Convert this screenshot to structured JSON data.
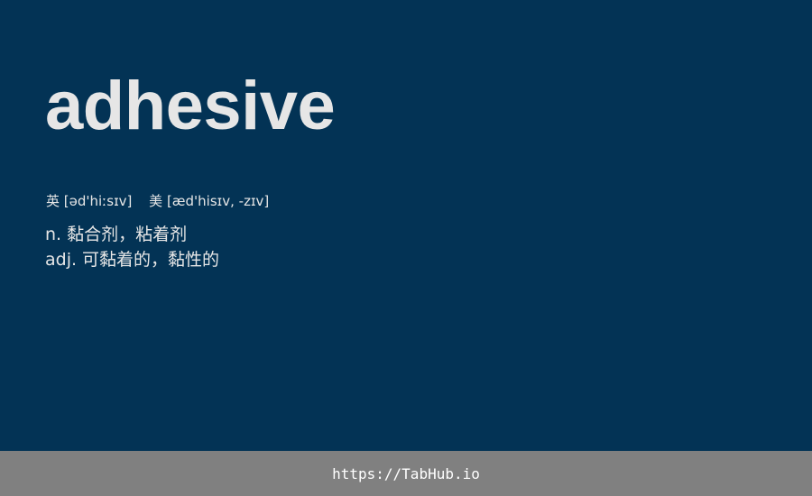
{
  "word": "adhesive",
  "phonetics": {
    "uk_label": "英",
    "uk": "[əd'hiːsɪv]",
    "us_label": "美",
    "us": "[æd'hisɪv, -zɪv]"
  },
  "definitions": [
    "n. 黏合剂，粘着剂",
    "adj. 可黏着的，黏性的"
  ],
  "footer": {
    "url": "https://TabHub.io"
  },
  "colors": {
    "background": "#033355",
    "text": "#e6e6e6",
    "footer_bg": "#808080",
    "footer_text": "#ffffff"
  }
}
